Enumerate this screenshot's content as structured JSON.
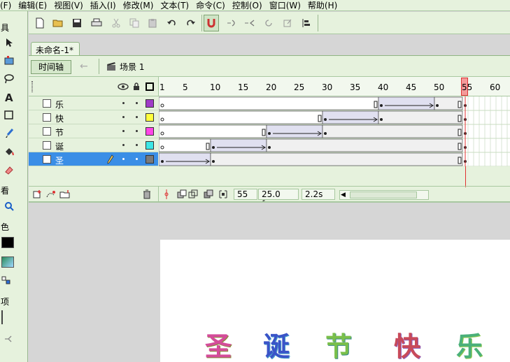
{
  "menu": {
    "items": [
      "(F)",
      "编辑(E)",
      "视图(V)",
      "插入(I)",
      "修改(M)",
      "文本(T)",
      "命令(C)",
      "控制(O)",
      "窗口(W)",
      "帮助(H)"
    ]
  },
  "tools_panel": {
    "labels": [
      "具",
      "看",
      "色",
      "项"
    ]
  },
  "document": {
    "tab_title": "未命名-1*"
  },
  "scene": {
    "timeline_button": "时间轴",
    "scene_name": "场景 1"
  },
  "ruler": {
    "ticks": [
      "1",
      "5",
      "10",
      "15",
      "20",
      "25",
      "30",
      "35",
      "40",
      "45",
      "50",
      "55",
      "60"
    ]
  },
  "layers": [
    {
      "name": "乐",
      "color": "#a03cc8",
      "selected": false
    },
    {
      "name": "快",
      "color": "#ffff3c",
      "selected": false
    },
    {
      "name": "节",
      "color": "#ff46e6",
      "selected": false
    },
    {
      "name": "诞",
      "color": "#3ce6e6",
      "selected": false
    },
    {
      "name": "圣",
      "color": "#7a7a7a",
      "selected": true
    }
  ],
  "status": {
    "current_frame": "55",
    "fps": "25.0 fps",
    "time": "2.2s"
  },
  "stage_text": [
    "圣",
    "诞",
    "节",
    "快",
    "乐"
  ],
  "colors": {
    "panel_bg": "#e6f2dd",
    "selection": "#3a8ee6",
    "playhead": "#e03030"
  }
}
